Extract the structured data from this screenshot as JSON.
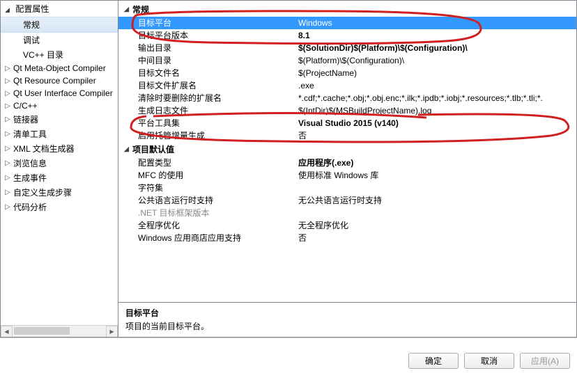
{
  "tree": {
    "header": "配置属性",
    "items": [
      {
        "label": "常规",
        "level": 1,
        "selected": true,
        "expander": ""
      },
      {
        "label": "调试",
        "level": 1,
        "expander": ""
      },
      {
        "label": "VC++ 目录",
        "level": 1,
        "expander": ""
      },
      {
        "label": "Qt Meta-Object Compiler",
        "level": 0,
        "expander": "▷"
      },
      {
        "label": "Qt Resource Compiler",
        "level": 0,
        "expander": "▷"
      },
      {
        "label": "Qt User Interface Compiler",
        "level": 0,
        "expander": "▷"
      },
      {
        "label": "C/C++",
        "level": 0,
        "expander": "▷"
      },
      {
        "label": "链接器",
        "level": 0,
        "expander": "▷"
      },
      {
        "label": "清单工具",
        "level": 0,
        "expander": "▷"
      },
      {
        "label": "XML 文档生成器",
        "level": 0,
        "expander": "▷"
      },
      {
        "label": "浏览信息",
        "level": 0,
        "expander": "▷"
      },
      {
        "label": "生成事件",
        "level": 0,
        "expander": "▷"
      },
      {
        "label": "自定义生成步骤",
        "level": 0,
        "expander": "▷"
      },
      {
        "label": "代码分析",
        "level": 0,
        "expander": "▷"
      }
    ]
  },
  "grid": {
    "sections": [
      {
        "title": "常规",
        "rows": [
          {
            "key": "目标平台",
            "val": "Windows",
            "selected": true
          },
          {
            "key": "目标平台版本",
            "val": "8.1",
            "bold": true
          },
          {
            "key": "输出目录",
            "val": "$(SolutionDir)$(Platform)\\$(Configuration)\\",
            "bold": true
          },
          {
            "key": "中间目录",
            "val": "$(Platform)\\$(Configuration)\\"
          },
          {
            "key": "目标文件名",
            "val": "$(ProjectName)"
          },
          {
            "key": "目标文件扩展名",
            "val": ".exe"
          },
          {
            "key": "清除时要删除的扩展名",
            "val": "*.cdf;*.cache;*.obj;*.obj.enc;*.ilk;*.ipdb;*.iobj;*.resources;*.tlb;*.tli;*."
          },
          {
            "key": "生成日志文件",
            "val": "$(IntDir)$(MSBuildProjectName).log"
          },
          {
            "key": "平台工具集",
            "val": "Visual Studio 2015 (v140)",
            "bold": true
          },
          {
            "key": "启用托管增量生成",
            "val": "否"
          }
        ]
      },
      {
        "title": "项目默认值",
        "rows": [
          {
            "key": "配置类型",
            "val": "应用程序(.exe)",
            "bold": true
          },
          {
            "key": "MFC 的使用",
            "val": "使用标准 Windows 库"
          },
          {
            "key": "字符集",
            "val": ""
          },
          {
            "key": "公共语言运行时支持",
            "val": "无公共语言运行时支持"
          },
          {
            "key": ".NET 目标框架版本",
            "val": "",
            "disabled": true
          },
          {
            "key": "全程序优化",
            "val": "无全程序优化"
          },
          {
            "key": "Windows 应用商店应用支持",
            "val": "否"
          }
        ]
      }
    ]
  },
  "desc": {
    "title": "目标平台",
    "text": "项目的当前目标平台。"
  },
  "buttons": {
    "ok": "确定",
    "cancel": "取消",
    "apply": "应用(A)"
  }
}
